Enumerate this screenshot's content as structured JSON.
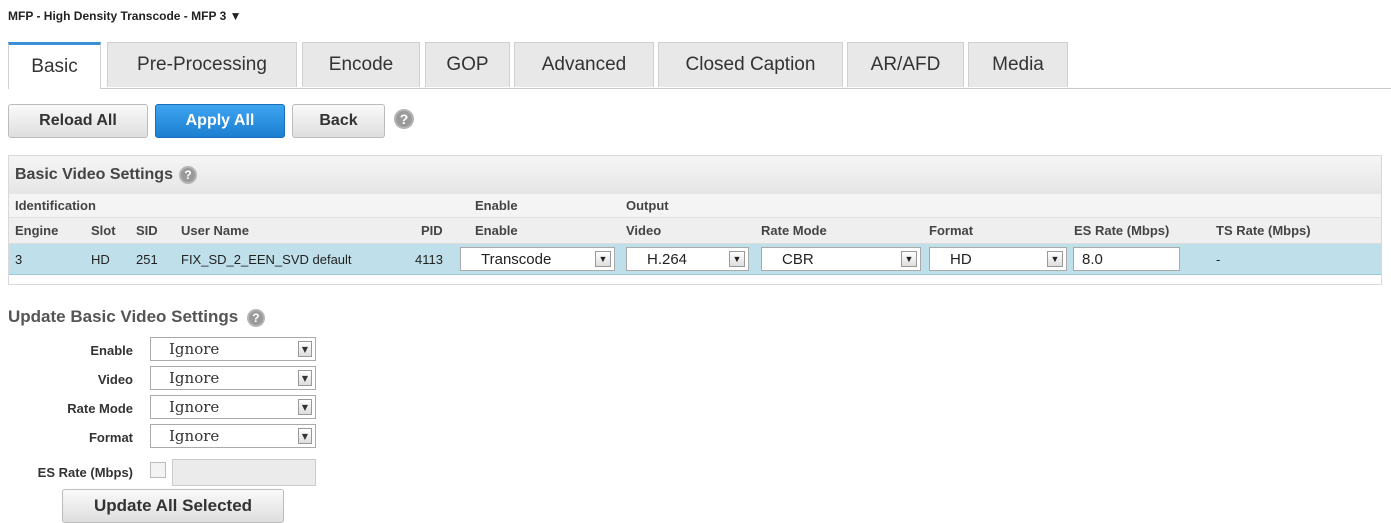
{
  "page": {
    "title": "MFP - High Density Transcode - MFP 3 ▼"
  },
  "tabs": [
    "Basic",
    "Pre-Processing",
    "Encode",
    "GOP",
    "Advanced",
    "Closed Caption",
    "AR/AFD",
    "Media"
  ],
  "toolbar": {
    "reload_label": "Reload All",
    "apply_label": "Apply All",
    "back_label": "Back"
  },
  "basic_video": {
    "title": "Basic Video Settings",
    "groups": {
      "identification": "Identification",
      "enable": "Enable",
      "output": "Output"
    },
    "columns": [
      "Engine",
      "Slot",
      "SID",
      "User Name",
      "PID",
      "Enable",
      "Video",
      "Rate Mode",
      "Format",
      "ES Rate (Mbps)",
      "TS Rate (Mbps)"
    ],
    "row": {
      "engine": "3",
      "slot": "HD",
      "sid": "251",
      "user_name": "FIX_SD_2_EEN_SVD default",
      "pid": "4113",
      "enable": "Transcode",
      "video": "H.264",
      "rate_mode": "CBR",
      "format": "HD",
      "es_rate": "8.0",
      "ts_rate": "-"
    }
  },
  "update": {
    "title": "Update Basic Video Settings",
    "fields": [
      {
        "label": "Enable",
        "value": "Ignore"
      },
      {
        "label": "Video",
        "value": "Ignore"
      },
      {
        "label": "Rate Mode",
        "value": "Ignore"
      },
      {
        "label": "Format",
        "value": "Ignore"
      }
    ],
    "es_rate_label": "ES Rate (Mbps)",
    "button_label": "Update All Selected"
  },
  "icons": {
    "help": "help-icon",
    "dropdown": "chevron-down-icon"
  },
  "colors": {
    "accent": "#1c7fd1",
    "selected_row": "#bfe0ea",
    "active_tab_border": "#3b8fd6"
  }
}
